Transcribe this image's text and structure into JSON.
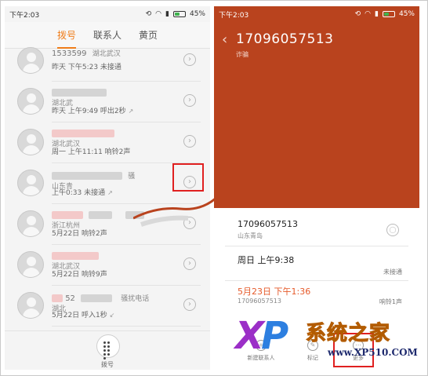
{
  "left": {
    "status": {
      "time": "下午2:03",
      "battery": "45%"
    },
    "tabs": [
      "拨号",
      "联系人",
      "黄页"
    ],
    "rows": [
      {
        "line1": "1533599",
        "line1b": "湖北武汉",
        "line2": "昨天 下午5:23 未接通"
      },
      {
        "line1": "",
        "line1b": "湖北武",
        "line2": "昨天 上午9:49 呼出2秒"
      },
      {
        "line1": "",
        "line1b": "湖北武汉",
        "line2": "周一 上午11:11 响铃2声"
      },
      {
        "line1": "",
        "line1b": "山东青",
        "extra": "骚",
        "line2": "上午0:33 未接通"
      },
      {
        "line1": "",
        "line1b": "浙江杭州",
        "line2": "5月22日 响铃2声"
      },
      {
        "line1": "",
        "line1b": "湖北武汉",
        "line2": "5月22日 响铃9声"
      },
      {
        "line1": "52",
        "line1b": "湖北",
        "extra": "骚扰电话",
        "line2": "5月22日 呼入1秒"
      }
    ],
    "dial_label": "拨号"
  },
  "right": {
    "status": {
      "time": "下午2:03",
      "battery": "45%"
    },
    "header": {
      "number": "17096057513",
      "tag": "诈骗"
    },
    "info": {
      "number": "17096057513",
      "location": "山东青岛",
      "call1_time": "周日 上午9:38",
      "call1_status": "未接通",
      "call2_time": "5月23日 下午1:36",
      "call2_number": "17096057513",
      "call2_status": "响铃1声"
    },
    "bottom": [
      "新建联系人",
      "标记",
      "更多"
    ]
  },
  "watermark": {
    "xp": "XP",
    "brand": "系统之家",
    "url": "www.XP510.COM"
  }
}
